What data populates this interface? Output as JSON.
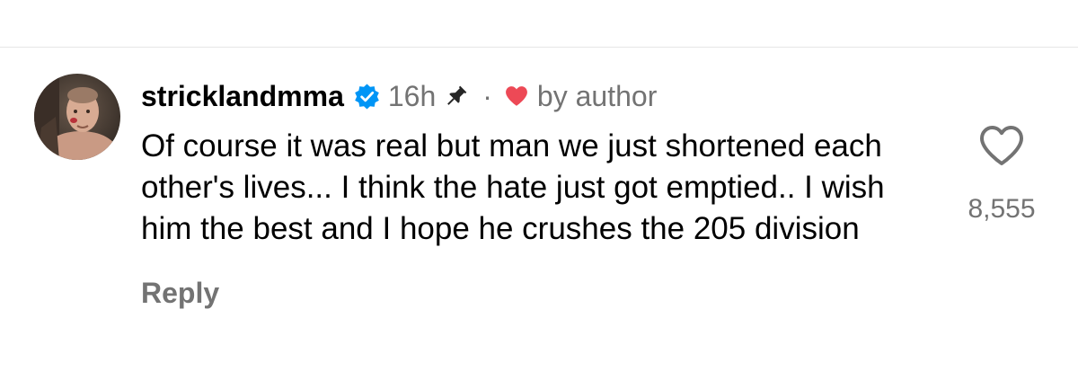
{
  "comment": {
    "username": "stricklandmma",
    "time": "16h",
    "separator": "·",
    "liked_by": "by author",
    "text": "Of course it was real but man we just shortened each other's lives... I think the hate just got emptied.. I wish him the best and I hope he crushes the 205 division",
    "reply_label": "Reply",
    "like_count": "8,555"
  },
  "icons": {
    "verified": "verified-badge-icon",
    "pin": "pin-icon",
    "liked_by_author": "heart-filled-icon",
    "like": "heart-outline-icon",
    "avatar": "avatar-image"
  },
  "colors": {
    "verified_blue": "#0095f6",
    "heart_red": "#ed4956",
    "secondary_text": "#737373"
  }
}
